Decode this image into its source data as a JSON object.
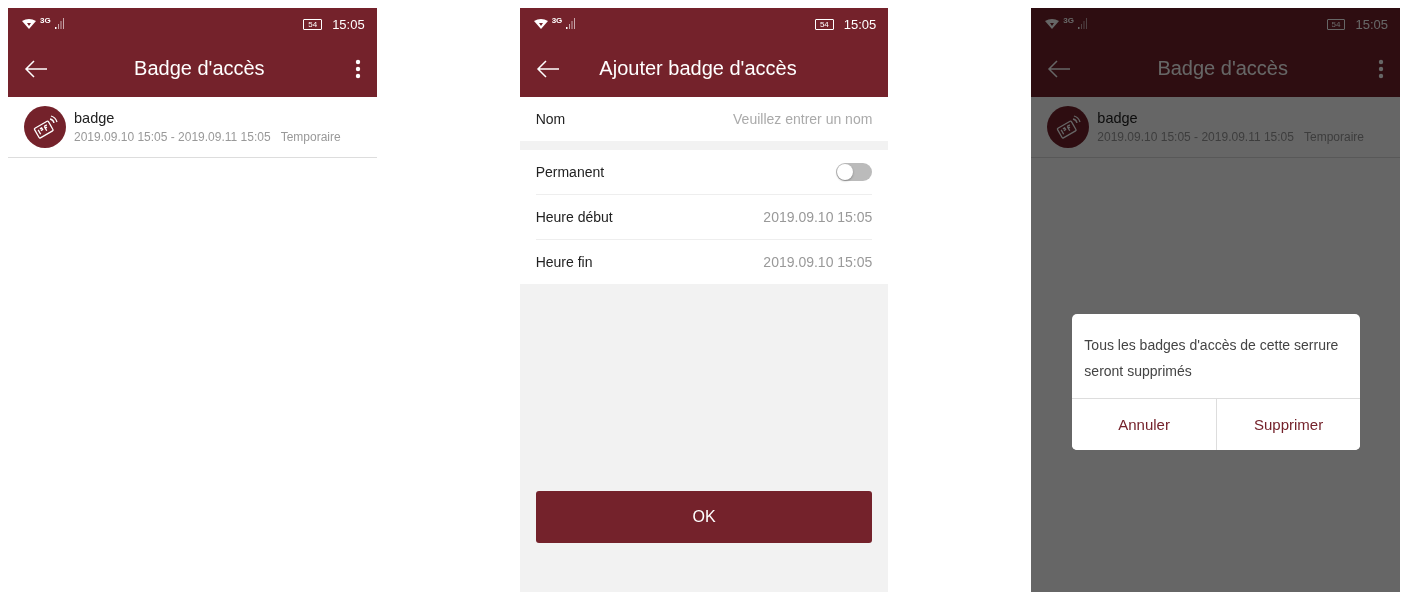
{
  "screens": [
    {
      "kind": "list",
      "status": {
        "network": "3G",
        "battery": "54",
        "time": "15:05"
      },
      "title": "Badge d'accès",
      "has_menu": true,
      "items": [
        {
          "name": "badge",
          "period": "2019.09.10 15:05 - 2019.09.11 15:05",
          "type": "Temporaire"
        }
      ]
    },
    {
      "kind": "form",
      "status": {
        "network": "3G",
        "battery": "54",
        "time": "15:05"
      },
      "title": "Ajouter badge d'accès",
      "has_menu": false,
      "name_field": {
        "label": "Nom",
        "placeholder": "Veuillez entrer un nom"
      },
      "rows": [
        {
          "kind": "toggle",
          "label": "Permanent",
          "on": false
        },
        {
          "kind": "value",
          "label": "Heure début",
          "value": "2019.09.10 15:05"
        },
        {
          "kind": "value",
          "label": "Heure fin",
          "value": "2019.09.10 15:05"
        }
      ],
      "button": "OK"
    },
    {
      "kind": "list",
      "status": {
        "network": "3G",
        "battery": "54",
        "time": "15:05"
      },
      "title": "Badge d'accès",
      "has_menu": true,
      "items": [
        {
          "name": "badge",
          "period": "2019.09.10 15:05 - 2019.09.11 15:05",
          "type": "Temporaire"
        }
      ],
      "dialog": {
        "message": "Tous les badges d'accès de cette serrure seront supprimés",
        "buttons": [
          "Annuler",
          "Supprimer"
        ]
      }
    }
  ]
}
